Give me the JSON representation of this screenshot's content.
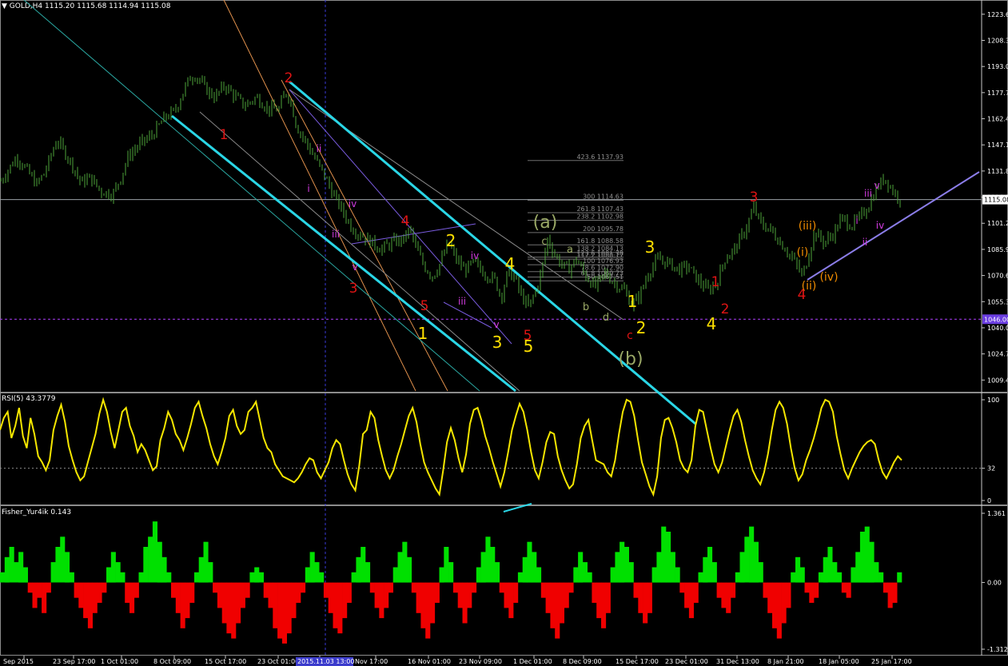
{
  "chart_data": [
    {
      "type": "candlestick",
      "header": "GOLD,H4  1115.20  1115.68  1114.94  1115.08",
      "yticks": [
        "1223.6",
        "1208.3",
        "1193.0",
        "1177.7",
        "1162.4",
        "1147.1",
        "1131.8",
        "1116.5",
        "1101.2",
        "1085.9",
        "1070.6",
        "1055.3",
        "1040.0",
        "1024.7",
        "1009.4"
      ],
      "ylim": [
        1003,
        1231
      ],
      "current_price": "1115.08",
      "current_price_tag": "1115.08",
      "hline_tag": "1046.00",
      "close_path": [
        [
          0,
          1126
        ],
        [
          10,
          1133
        ],
        [
          20,
          1140
        ],
        [
          30,
          1134
        ],
        [
          45,
          1124
        ],
        [
          55,
          1131
        ],
        [
          70,
          1150
        ],
        [
          80,
          1143
        ],
        [
          90,
          1135
        ],
        [
          100,
          1125
        ],
        [
          112,
          1128
        ],
        [
          125,
          1120
        ],
        [
          140,
          1118
        ],
        [
          150,
          1128
        ],
        [
          160,
          1141
        ],
        [
          175,
          1148
        ],
        [
          190,
          1153
        ],
        [
          205,
          1163
        ],
        [
          218,
          1167
        ],
        [
          228,
          1178
        ],
        [
          236,
          1186
        ],
        [
          244,
          1188
        ],
        [
          256,
          1180
        ],
        [
          268,
          1175
        ],
        [
          280,
          1182
        ],
        [
          292,
          1176
        ],
        [
          305,
          1170
        ],
        [
          320,
          1175
        ],
        [
          335,
          1168
        ],
        [
          348,
          1168
        ],
        [
          356,
          1178
        ],
        [
          362,
          1174
        ],
        [
          370,
          1158
        ],
        [
          380,
          1150
        ],
        [
          392,
          1140
        ],
        [
          404,
          1130
        ],
        [
          416,
          1118
        ],
        [
          428,
          1108
        ],
        [
          440,
          1098
        ],
        [
          452,
          1094
        ],
        [
          464,
          1090
        ],
        [
          476,
          1086
        ],
        [
          490,
          1090
        ],
        [
          504,
          1092
        ],
        [
          512,
          1098
        ],
        [
          520,
          1086
        ],
        [
          530,
          1076
        ],
        [
          540,
          1070
        ],
        [
          550,
          1078
        ],
        [
          560,
          1090
        ],
        [
          570,
          1080
        ],
        [
          580,
          1074
        ],
        [
          592,
          1078
        ],
        [
          605,
          1072
        ],
        [
          618,
          1068
        ],
        [
          626,
          1058
        ],
        [
          634,
          1072
        ],
        [
          642,
          1070
        ],
        [
          650,
          1060
        ],
        [
          660,
          1052
        ],
        [
          668,
          1060
        ],
        [
          676,
          1072
        ],
        [
          684,
          1092
        ],
        [
          692,
          1084
        ],
        [
          700,
          1078
        ],
        [
          710,
          1074
        ],
        [
          720,
          1080
        ],
        [
          732,
          1070
        ],
        [
          744,
          1064
        ],
        [
          756,
          1072
        ],
        [
          768,
          1066
        ],
        [
          780,
          1062
        ],
        [
          790,
          1053
        ],
        [
          800,
          1060
        ],
        [
          810,
          1072
        ],
        [
          822,
          1080
        ],
        [
          835,
          1078
        ],
        [
          848,
          1074
        ],
        [
          860,
          1076
        ],
        [
          872,
          1068
        ],
        [
          885,
          1062
        ],
        [
          896,
          1066
        ],
        [
          905,
          1080
        ],
        [
          918,
          1086
        ],
        [
          930,
          1096
        ],
        [
          942,
          1110
        ],
        [
          952,
          1100
        ],
        [
          962,
          1098
        ],
        [
          972,
          1092
        ],
        [
          982,
          1086
        ],
        [
          994,
          1078
        ],
        [
          1003,
          1070
        ],
        [
          1010,
          1082
        ],
        [
          1018,
          1096
        ],
        [
          1030,
          1090
        ],
        [
          1040,
          1094
        ],
        [
          1052,
          1104
        ],
        [
          1064,
          1100
        ],
        [
          1074,
          1104
        ],
        [
          1086,
          1112
        ],
        [
          1096,
          1122
        ],
        [
          1106,
          1128
        ],
        [
          1116,
          1120
        ],
        [
          1126,
          1115
        ]
      ],
      "xlabels": [
        "Sep 2015",
        "23 Sep 17:00",
        "1 Oct 01:00",
        "8 Oct 09:00",
        "15 Oct 17:00",
        "23 Oct 01:00",
        "2015.11.03 13:00",
        "Nov 17:00",
        "16 Nov 01:00",
        "23 Nov 09:00",
        "1 Dec 01:00",
        "8 Dec 09:00",
        "15 Dec 17:00",
        "23 Dec 01:00",
        "31 Dec 13:00",
        "8 Jan 21:00",
        "18 Jan 05:00",
        "25 Jan 17:00"
      ],
      "fibo_levels": [
        "423.6  1137.93",
        "300  1114.63",
        "261.8  1107.43",
        "238.2  1102.98",
        "200  1095.78",
        "161.8  1088.58",
        "138.2  1084.13",
        "123.6  1081.38",
        "117.2  1080.17",
        "100  1076.93",
        "78.6  1072.90",
        "61.8  1069.73",
        "50  1067.51"
      ],
      "wave_labels_red": [
        "2",
        "1",
        "3",
        "4",
        "5",
        "5",
        "3",
        "1",
        "2",
        "4"
      ],
      "wave_labels_yellow": [
        "2",
        "4",
        "3",
        "5",
        "1",
        "1",
        "2",
        "3",
        "4"
      ],
      "wave_labels_green": [
        "(a)",
        "(b)",
        "a",
        "b",
        "c",
        "d"
      ],
      "wave_labels_magenta": [
        "ii",
        "i",
        "iii",
        "iv",
        "v",
        "iii",
        "iv",
        "v",
        "iii",
        "i",
        "v",
        "iv",
        "ii"
      ],
      "wave_labels_orange": [
        "(iii)",
        "(i)",
        "(ii)",
        "(iv)",
        "c"
      ]
    },
    {
      "type": "line",
      "header": "RSI(5) 43.3779",
      "yticks": [
        "100",
        "32",
        "0"
      ],
      "ylim": [
        0,
        100
      ],
      "level": 32,
      "values": [
        70,
        82,
        88,
        62,
        74,
        92,
        64,
        52,
        82,
        66,
        44,
        38,
        30,
        40,
        70,
        84,
        95,
        78,
        54,
        40,
        28,
        20,
        24,
        38,
        52,
        66,
        86,
        100,
        88,
        68,
        52,
        70,
        88,
        92,
        74,
        64,
        48,
        56,
        50,
        40,
        30,
        34,
        60,
        72,
        88,
        80,
        66,
        60,
        50,
        62,
        76,
        92,
        98,
        84,
        72,
        56,
        44,
        36,
        48,
        62,
        84,
        90,
        74,
        66,
        70,
        88,
        92,
        98,
        80,
        62,
        52,
        48,
        36,
        30,
        24,
        22,
        20,
        18,
        22,
        28,
        36,
        42,
        40,
        28,
        22,
        30,
        38,
        52,
        60,
        56,
        40,
        26,
        16,
        10,
        34,
        66,
        70,
        88,
        82,
        60,
        44,
        30,
        22,
        30,
        44,
        56,
        70,
        84,
        92,
        78,
        56,
        38,
        28,
        20,
        12,
        6,
        30,
        58,
        72,
        60,
        42,
        28,
        46,
        76,
        90,
        92,
        80,
        64,
        52,
        38,
        26,
        14,
        28,
        48,
        70,
        84,
        96,
        88,
        70,
        48,
        30,
        22,
        38,
        58,
        68,
        66,
        44,
        30,
        20,
        12,
        16,
        36,
        62,
        74,
        80,
        60,
        40,
        38,
        36,
        28,
        24,
        40,
        66,
        88,
        100,
        98,
        84,
        60,
        38,
        26,
        14,
        6,
        24,
        62,
        80,
        82,
        72,
        58,
        40,
        32,
        28,
        40,
        74,
        90,
        88,
        70,
        52,
        36,
        28,
        38,
        54,
        70,
        84,
        90,
        78,
        60,
        44,
        30,
        22,
        16,
        28,
        46,
        70,
        90,
        98,
        92,
        76,
        52,
        32,
        20,
        26,
        40,
        50,
        62,
        76,
        92,
        100,
        98,
        88,
        64,
        46,
        30,
        22,
        32,
        40,
        48,
        54,
        58,
        60,
        56,
        40,
        28,
        22,
        30,
        38,
        44,
        40
      ]
    },
    {
      "type": "bar",
      "header": "Fisher_Yur4ik 0.143",
      "yticks": [
        "1.361",
        "0.00",
        "-1.312"
      ],
      "ylim": [
        -1.312,
        1.361
      ],
      "values": [
        0.2,
        0.5,
        0.7,
        0.4,
        0.6,
        0.3,
        -0.2,
        -0.5,
        -0.3,
        -0.6,
        -0.2,
        0.4,
        0.7,
        0.9,
        0.6,
        0.2,
        -0.3,
        -0.5,
        -0.7,
        -0.9,
        -0.6,
        -0.4,
        -0.2,
        0.3,
        0.6,
        0.4,
        0.2,
        -0.4,
        -0.6,
        -0.3,
        0.2,
        0.7,
        0.9,
        1.2,
        0.8,
        0.5,
        0.2,
        -0.3,
        -0.6,
        -0.9,
        -0.7,
        -0.4,
        0.2,
        0.5,
        0.8,
        0.4,
        -0.2,
        -0.5,
        -0.8,
        -1.0,
        -1.1,
        -0.8,
        -0.5,
        -0.3,
        0.2,
        0.3,
        0.2,
        -0.3,
        -0.5,
        -0.9,
        -1.1,
        -1.2,
        -1.0,
        -0.7,
        -0.4,
        -0.2,
        0.3,
        0.6,
        0.4,
        0.2,
        -0.3,
        -0.6,
        -0.9,
        -1.0,
        -0.7,
        -0.4,
        0.2,
        0.5,
        0.7,
        0.4,
        -0.2,
        -0.5,
        -0.7,
        -0.5,
        -0.2,
        0.3,
        0.6,
        0.8,
        0.5,
        -0.2,
        -0.6,
        -0.9,
        -1.1,
        -0.8,
        -0.4,
        0.3,
        0.7,
        0.4,
        -0.2,
        -0.5,
        -0.8,
        -0.5,
        -0.2,
        0.3,
        0.6,
        0.9,
        0.7,
        0.4,
        -0.2,
        -0.5,
        -0.7,
        -0.4,
        0.2,
        0.5,
        0.8,
        0.6,
        0.3,
        -0.3,
        -0.6,
        -0.9,
        -1.1,
        -0.8,
        -0.5,
        -0.2,
        0.3,
        0.6,
        0.4,
        0.2,
        -0.4,
        -0.7,
        -0.9,
        -0.6,
        0.3,
        0.6,
        0.8,
        0.7,
        0.4,
        -0.3,
        -0.6,
        -0.8,
        -0.6,
        0.3,
        0.6,
        1.1,
        1.0,
        0.6,
        0.3,
        -0.2,
        -0.5,
        -0.7,
        -0.4,
        0.2,
        0.5,
        0.7,
        0.4,
        -0.3,
        -0.5,
        -0.6,
        -0.3,
        0.2,
        0.6,
        0.9,
        1.1,
        0.8,
        0.4,
        -0.3,
        -0.6,
        -0.9,
        -1.1,
        -0.8,
        -0.5,
        0.2,
        0.5,
        0.3,
        -0.2,
        -0.4,
        -0.3,
        0.2,
        0.5,
        0.7,
        0.4,
        0.2,
        -0.2,
        -0.3,
        0.3,
        0.6,
        1.0,
        1.1,
        0.8,
        0.4,
        0.2,
        -0.2,
        -0.5,
        -0.4,
        0.2
      ]
    }
  ]
}
